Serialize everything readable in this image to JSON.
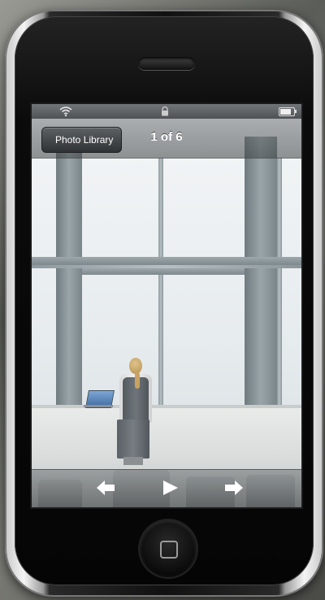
{
  "status_bar": {
    "wifi_icon": "wifi-icon",
    "lock_icon": "lock-icon",
    "battery_icon": "battery-icon"
  },
  "nav": {
    "back_label": "Photo Library",
    "title": "1 of 6"
  },
  "toolbar": {
    "prev_icon": "arrow-left-icon",
    "play_icon": "play-icon",
    "next_icon": "arrow-right-icon"
  },
  "colors": {
    "bar_background": "#4a4e50",
    "bar_text": "#ffffff"
  }
}
